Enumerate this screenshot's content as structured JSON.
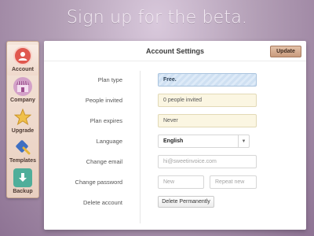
{
  "headline": "Sign up for the beta.",
  "sidebar": {
    "items": [
      {
        "label": "Account",
        "icon": "user-icon"
      },
      {
        "label": "Company",
        "icon": "storefront-icon"
      },
      {
        "label": "Upgrade",
        "icon": "star-icon"
      },
      {
        "label": "Templates",
        "icon": "paintbrush-icon"
      },
      {
        "label": "Backup",
        "icon": "download-icon"
      }
    ],
    "active": "Account"
  },
  "panel": {
    "title": "Account Settings",
    "update_label": "Update"
  },
  "form": {
    "plan_type": {
      "label": "Plan type",
      "value": "Free."
    },
    "people_invited": {
      "label": "People invited",
      "value": "0 people invited"
    },
    "plan_expires": {
      "label": "Plan expires",
      "value": "Never"
    },
    "language": {
      "label": "Language",
      "value": "English"
    },
    "change_email": {
      "label": "Change email",
      "placeholder": "hi@sweetinvoice.com"
    },
    "change_password": {
      "label": "Change password",
      "new_placeholder": "New",
      "repeat_placeholder": "Repeat new"
    },
    "delete_account": {
      "label": "Delete account",
      "button_label": "Delete Permanently"
    }
  },
  "colors": {
    "accent": "#c99b7d",
    "active_icon": "#e0584f",
    "stripe_field": "#cfe0f2",
    "cream_field": "#fbf6e2"
  }
}
